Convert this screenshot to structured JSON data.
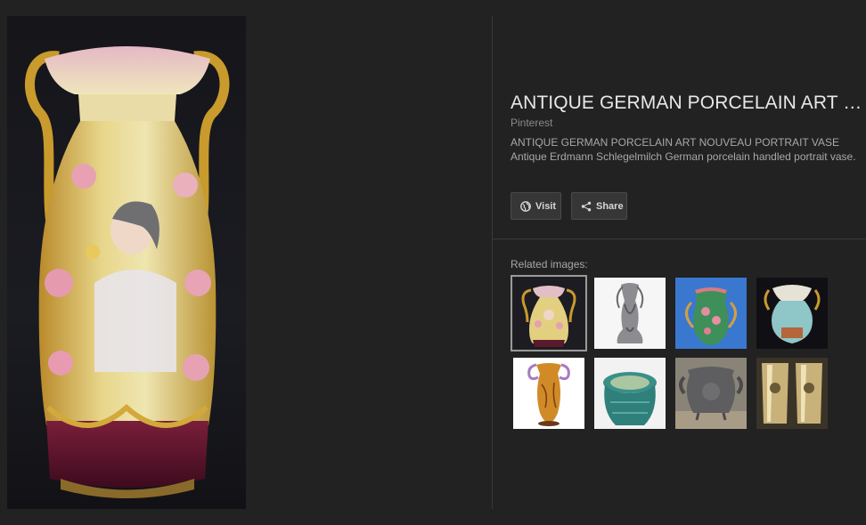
{
  "details": {
    "title": "ANTIQUE GERMAN PORCELAIN ART …",
    "source": "Pinterest",
    "description": "ANTIQUE GERMAN PORCELAIN ART NOUVEAU PORTRAIT VASE Antique Erdmann Schlegelmilch German porcelain handled portrait vase."
  },
  "actions": {
    "visit_label": "Visit",
    "visit_icon": "globe-icon",
    "share_label": "Share",
    "share_icon": "share-icon"
  },
  "related": {
    "label": "Related images:",
    "selected_index": 0
  },
  "colors": {
    "background": "#222222",
    "divider": "#3a3a3a",
    "button_bg": "#363636"
  }
}
